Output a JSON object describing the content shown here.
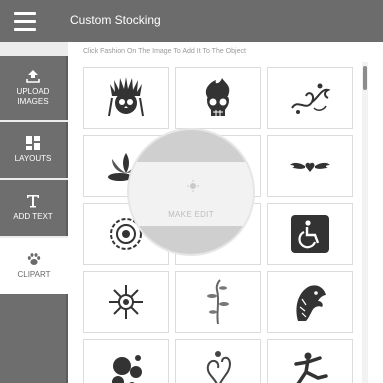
{
  "header": {
    "title": "Custom Stocking",
    "menu_icon": "hamburger-menu-icon"
  },
  "sidebar": {
    "items": [
      {
        "label_line1": "UPLOAD",
        "label_line2": "IMAGES",
        "icon": "upload-icon"
      },
      {
        "label_line1": "LAYOUTS",
        "label_line2": "",
        "icon": "layouts-icon"
      },
      {
        "label_line1": "ADD TEXT",
        "label_line2": "",
        "icon": "text-icon"
      },
      {
        "label_line1": "CLIPART",
        "label_line2": "",
        "icon": "paw-icon",
        "active": true
      }
    ]
  },
  "content": {
    "hint": "Click Fashion On The Image To Add It To The Object",
    "clipart_items": [
      "native-headdress-skull",
      "flaming-skull",
      "ornamental-swirl",
      "lotus-flower",
      "",
      "winged-heart",
      "mandala-flower",
      "",
      "wheelchair-sign",
      "flower-burst",
      "vine-plant",
      "eagle-head",
      "flower-cluster",
      "floral-swirl",
      "martial-artist"
    ]
  },
  "overlay": {
    "label": "MAKE EDIT",
    "icon": "sun-icon"
  },
  "colors": {
    "header": "#6c6c6c",
    "sidebar": "#6e6e6e",
    "active_item": "#ffffff",
    "background": "#ffffff"
  }
}
